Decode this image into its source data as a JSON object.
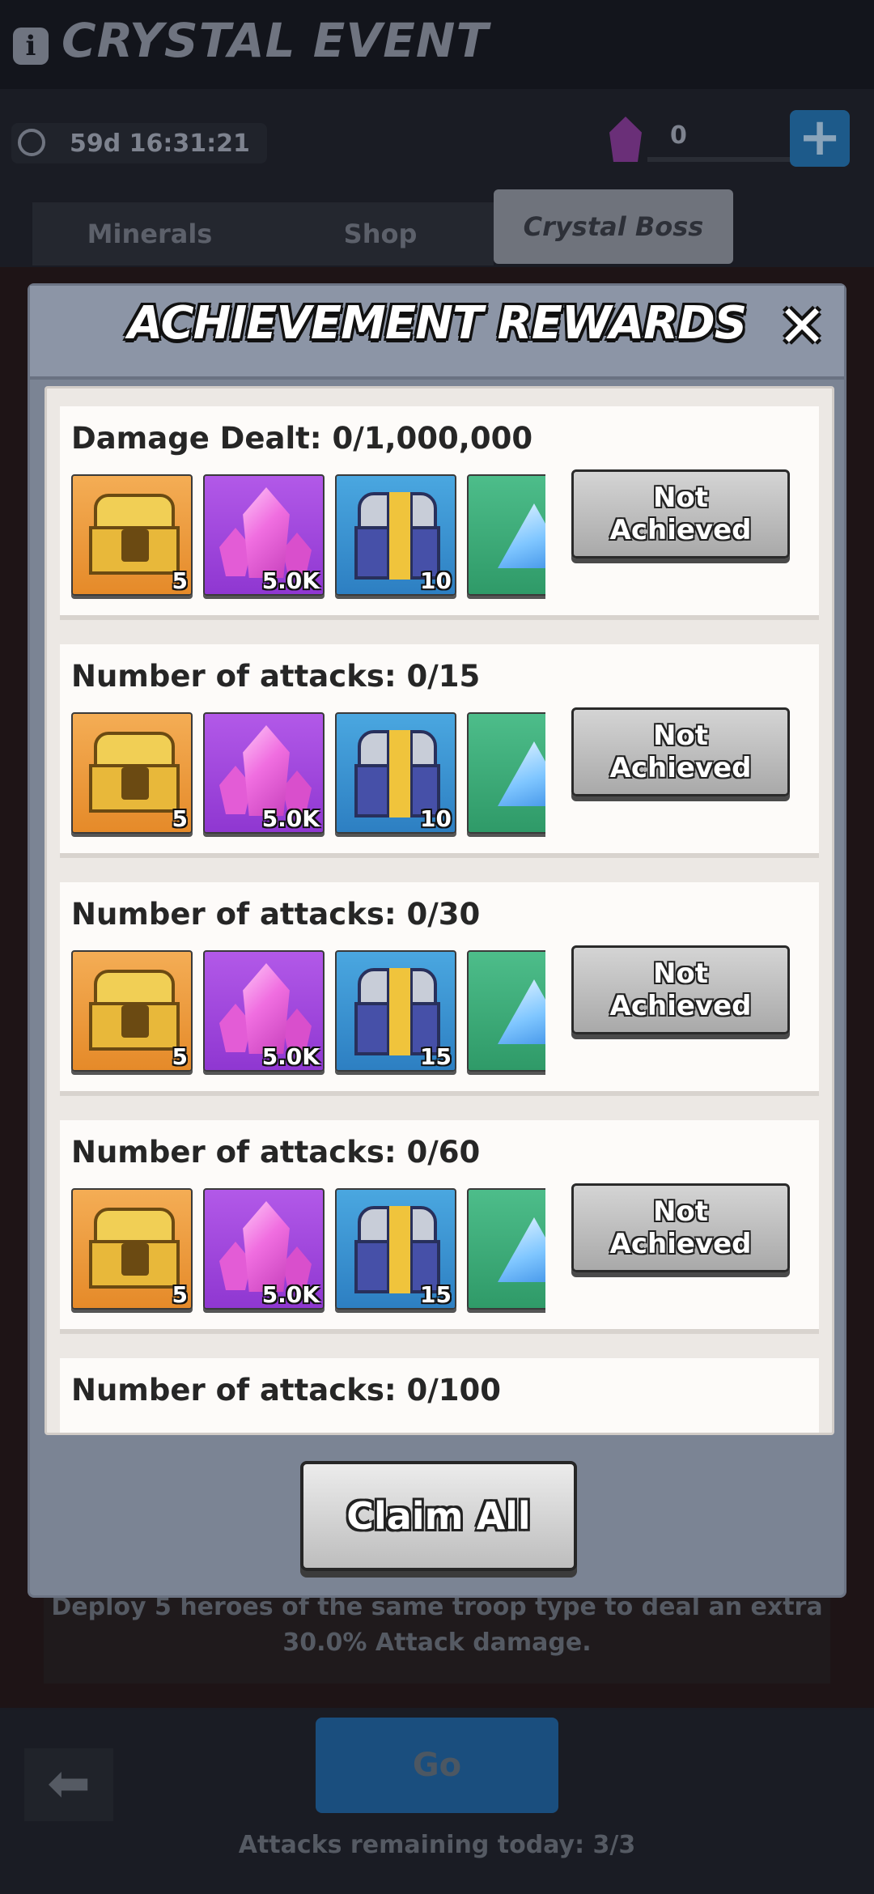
{
  "background": {
    "event_title": "CRYSTAL EVENT",
    "timer": "59d 16:31:21",
    "crystal_count": "0",
    "tabs": [
      {
        "label": "Minerals"
      },
      {
        "label": "Shop"
      },
      {
        "label": "Crystal Boss"
      }
    ],
    "description": "Deploy 5 heroes of the same troop type to deal an extra 30.0% Attack damage.",
    "go_label": "Go",
    "attacks_remaining": "Attacks remaining today: 3/3"
  },
  "modal": {
    "title": "ACHIEVEMENT REWARDS",
    "close_label": "✕",
    "claim_all_label": "Claim All",
    "cards": [
      {
        "title": "Damage Dealt: 0/1,000,000",
        "button": "Not Achieved",
        "rewards": [
          {
            "icon": "gold-chest-icon",
            "qty": "5"
          },
          {
            "icon": "pink-crystal-icon",
            "qty": "5.0K"
          },
          {
            "icon": "blue-chest-icon",
            "qty": "10"
          },
          {
            "icon": "blue-triangle-gem-icon",
            "qty": ""
          }
        ]
      },
      {
        "title": "Number of attacks: 0/15",
        "button": "Not Achieved",
        "rewards": [
          {
            "icon": "gold-chest-icon",
            "qty": "5"
          },
          {
            "icon": "pink-crystal-icon",
            "qty": "5.0K"
          },
          {
            "icon": "blue-chest-icon",
            "qty": "10"
          },
          {
            "icon": "blue-triangle-gem-icon",
            "qty": ""
          }
        ]
      },
      {
        "title": "Number of attacks: 0/30",
        "button": "Not Achieved",
        "rewards": [
          {
            "icon": "gold-chest-icon",
            "qty": "5"
          },
          {
            "icon": "pink-crystal-icon",
            "qty": "5.0K"
          },
          {
            "icon": "blue-chest-icon",
            "qty": "15"
          },
          {
            "icon": "blue-triangle-gem-icon",
            "qty": ""
          }
        ]
      },
      {
        "title": "Number of attacks: 0/60",
        "button": "Not Achieved",
        "rewards": [
          {
            "icon": "gold-chest-icon",
            "qty": "5"
          },
          {
            "icon": "pink-crystal-icon",
            "qty": "5.0K"
          },
          {
            "icon": "blue-chest-icon",
            "qty": "15"
          },
          {
            "icon": "blue-triangle-gem-icon",
            "qty": ""
          }
        ]
      },
      {
        "title": "Number of attacks: 0/100"
      }
    ]
  }
}
